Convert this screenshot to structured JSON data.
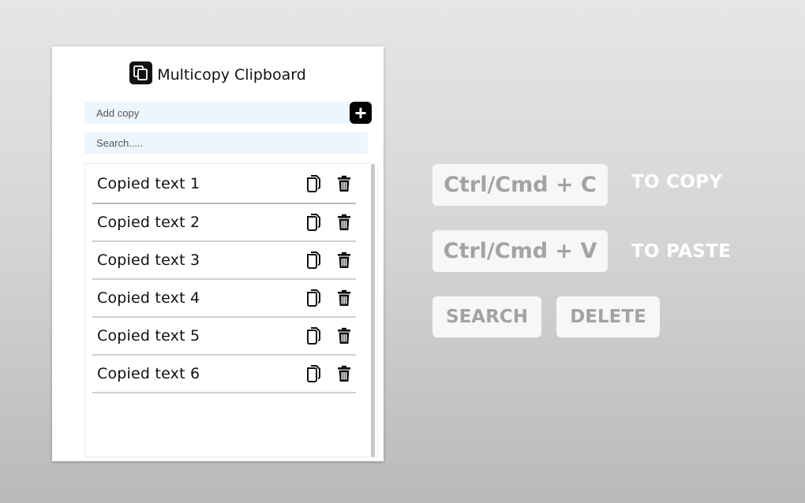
{
  "popup": {
    "title": "Multicopy Clipboard",
    "logo_icon": "copy-stack-icon",
    "add_placeholder": "Add copy",
    "add_button_label": "+",
    "search_placeholder": "Search.....",
    "items": [
      {
        "text": "Copied text 1"
      },
      {
        "text": "Copied text 2"
      },
      {
        "text": "Copied text 3"
      },
      {
        "text": "Copied text 4"
      },
      {
        "text": "Copied text 5"
      },
      {
        "text": "Copied text 6"
      }
    ],
    "item_icons": [
      "copy-icon",
      "trash-icon"
    ]
  },
  "shortcuts": {
    "copy_key": "Ctrl/Cmd + C",
    "copy_label": "TO COPY",
    "paste_key": "Ctrl/Cmd + V",
    "paste_label": "TO PASTE",
    "search_key": "SEARCH",
    "delete_key": "DELETE"
  },
  "colors": {
    "background_top": "#e6e6e6",
    "background_bottom": "#b9b9b9",
    "input_bg": "#eef6fd",
    "key_bg": "#f7f7f7",
    "key_text": "#a3a3a3",
    "label_text": "#ffffff",
    "accent": "#000000"
  }
}
